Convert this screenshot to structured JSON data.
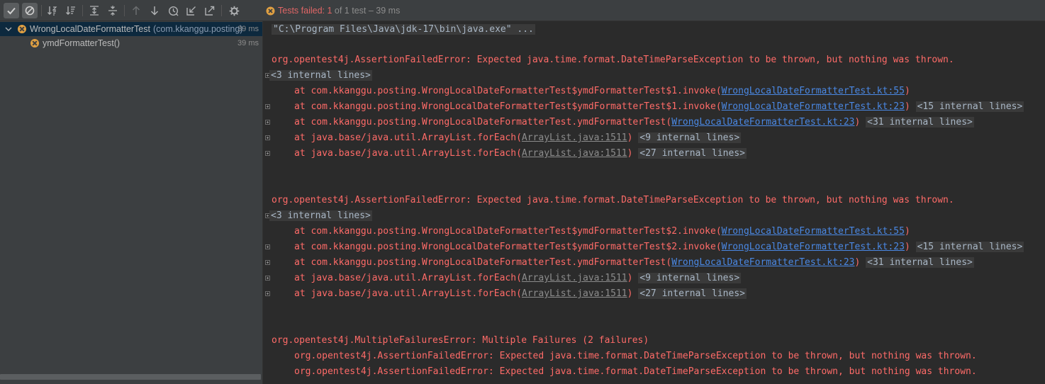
{
  "toolbar": {
    "buttons": [
      {
        "name": "show-passed",
        "icon": "check-icon",
        "active": true
      },
      {
        "name": "show-ignored",
        "icon": "ignore-icon",
        "active": true
      },
      {
        "name": "sort-alpha",
        "icon": "sort-alphabetically-icon"
      },
      {
        "name": "sort-duration",
        "icon": "sort-duration-icon"
      },
      {
        "name": "expand-all",
        "icon": "expand-all-icon"
      },
      {
        "name": "collapse-all",
        "icon": "collapse-all-icon"
      },
      {
        "name": "prev-failed",
        "icon": "arrow-up-icon"
      },
      {
        "name": "next-failed",
        "icon": "arrow-down-icon"
      },
      {
        "name": "history",
        "icon": "clock-icon"
      },
      {
        "name": "import",
        "icon": "import-icon"
      },
      {
        "name": "export",
        "icon": "export-icon"
      },
      {
        "name": "settings",
        "icon": "gear-icon"
      }
    ]
  },
  "status": {
    "icon": "failed-icon",
    "label": "Tests failed: ",
    "failed": "1",
    "rest": " of 1 test – 39 ms"
  },
  "tree": {
    "suite": {
      "name": "WrongLocalDateFormatterTest",
      "package": "(com.kkanggu.posting)",
      "time": "39 ms"
    },
    "test": {
      "name": "ymdFormatterTest()",
      "time": "39 ms"
    }
  },
  "console": {
    "command": "\"C:\\Program Files\\Java\\jdk-17\\bin\\java.exe\" ...",
    "error1": "org.opentest4j.AssertionFailedError: Expected java.time.format.DateTimeParseException to be thrown, but nothing was thrown.",
    "fold3": "<3 internal lines>",
    "fold15": "<15 internal lines>",
    "fold31": "<31 internal lines>",
    "fold9": "<9 internal lines>",
    "fold27": "<27 internal lines>",
    "at_invoke1": "at com.kkanggu.posting.WrongLocalDateFormatterTest$ymdFormatterTest$1.invoke(",
    "at_invoke2": "at com.kkanggu.posting.WrongLocalDateFormatterTest$ymdFormatterTest$2.invoke(",
    "at_ymd": "at com.kkanggu.posting.WrongLocalDateFormatterTest.ymdFormatterTest(",
    "at_foreach": "at java.base/java.util.ArrayList.forEach(",
    "link55": "WrongLocalDateFormatterTest.kt:55",
    "link23": "WrongLocalDateFormatterTest.kt:23",
    "link1511": "ArrayList.java:1511",
    "close": ")",
    "close_sp": ") ",
    "multi": "org.opentest4j.MultipleFailuresError: Multiple Failures (2 failures)",
    "sub1": "org.opentest4j.AssertionFailedError: Expected java.time.format.DateTimeParseException to be thrown, but nothing was thrown.",
    "sub2": "org.opentest4j.AssertionFailedError: Expected java.time.format.DateTimeParseException to be thrown, but nothing was thrown."
  }
}
